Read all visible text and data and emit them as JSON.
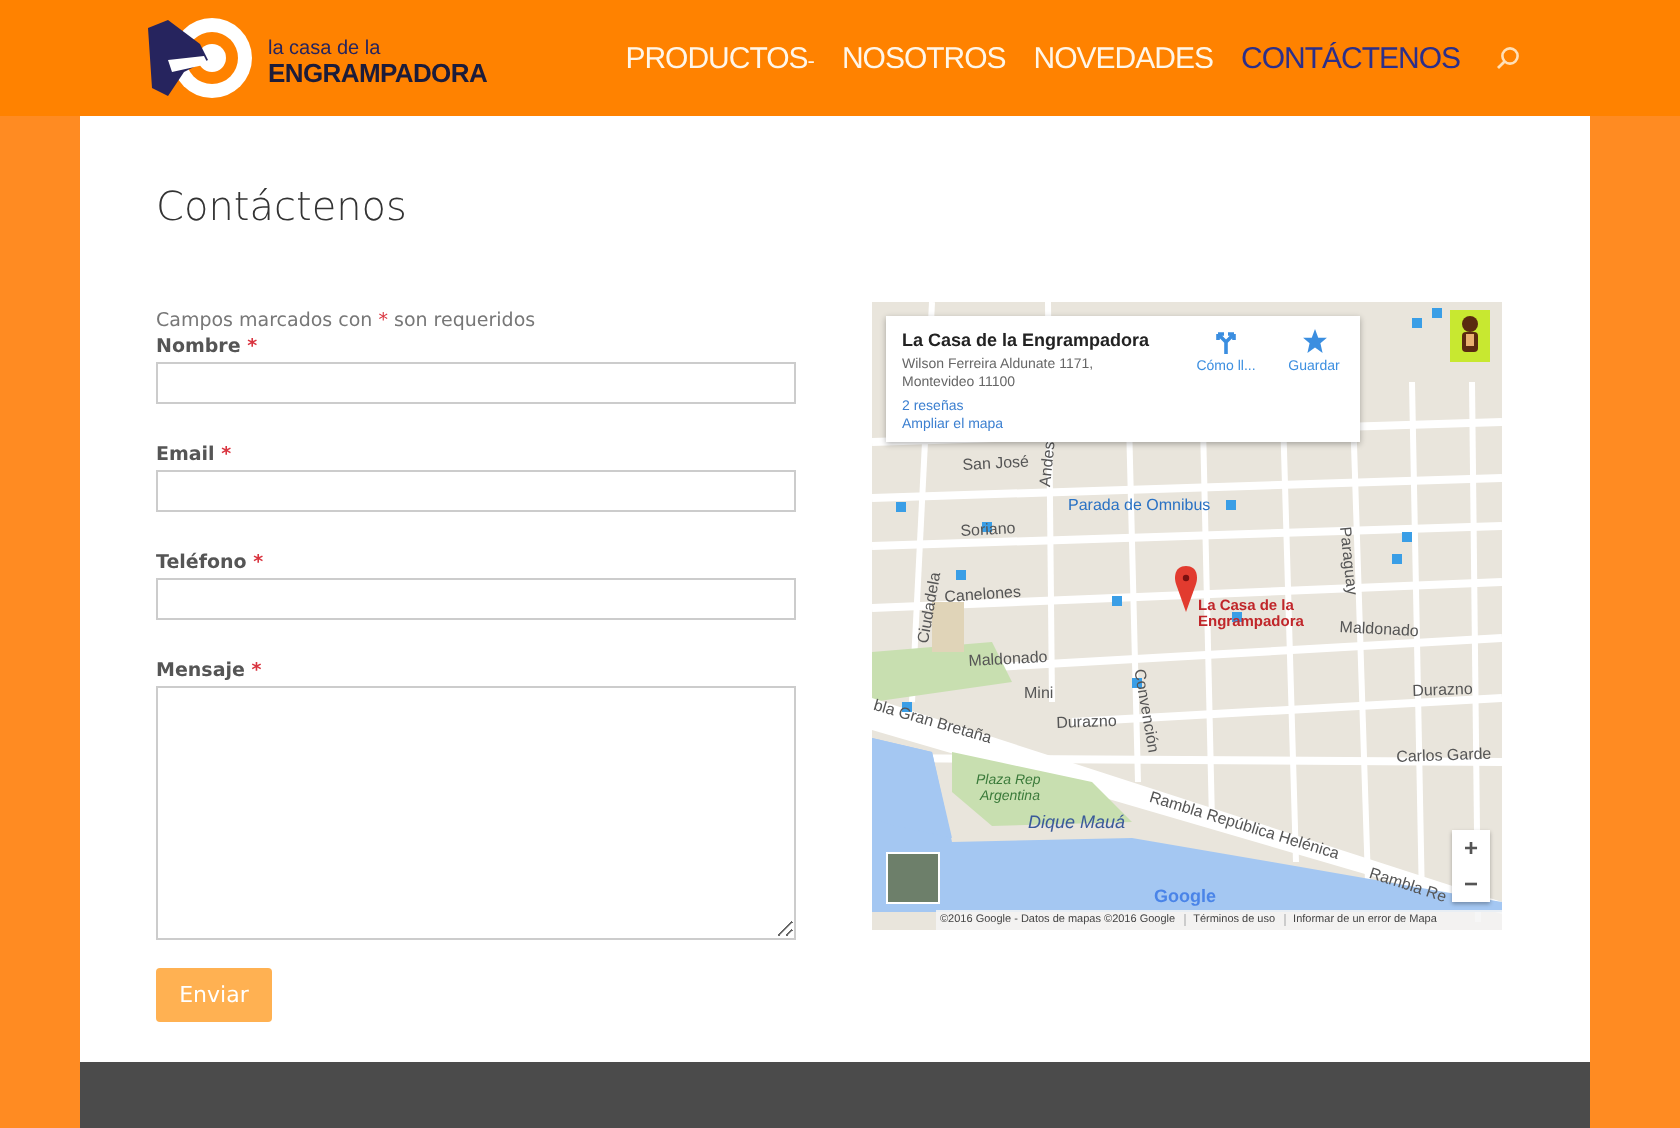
{
  "header": {
    "logo": {
      "line_1": "la casa de la",
      "line_2": "ENGRAMPADORA"
    },
    "nav": [
      {
        "label": "PRODUCTOS",
        "submenu_mark": "-",
        "selected": false
      },
      {
        "label": "NOSOTROS",
        "selected": false
      },
      {
        "label": "NOVEDADES",
        "selected": false
      },
      {
        "label": "CONTÁCTENOS",
        "selected": true
      }
    ]
  },
  "page": {
    "title": "Contáctenos"
  },
  "form": {
    "note": {
      "before": "Campos marcados con",
      "mark": "*",
      "after": "son requeridos"
    },
    "fields": [
      {
        "kind": "input",
        "label": "Nombre",
        "mark": "*"
      },
      {
        "kind": "input",
        "label": "Email",
        "mark": "*"
      },
      {
        "kind": "input",
        "label": "Teléfono",
        "mark": "*"
      },
      {
        "kind": "textarea",
        "label": "Mensaje",
        "mark": "*"
      }
    ],
    "submit": "Enviar"
  },
  "map": {
    "info_card": {
      "title": "La Casa de la Engrampadora",
      "address": [
        "Wilson Ferreira Aldunate 1171,",
        "Montevideo 11100"
      ],
      "links": [
        "2 reseñas",
        "Ampliar el mapa"
      ],
      "actions": [
        {
          "kind": "directions",
          "label": "Cómo ll..."
        },
        {
          "kind": "save",
          "label": "Guardar"
        }
      ]
    },
    "marker_label": [
      "La Casa de la",
      "Engrampadora"
    ],
    "labels": [
      {
        "text": "San José"
      },
      {
        "text": "Andes"
      },
      {
        "text": "Parada de Omnibus"
      },
      {
        "text": "Soriano"
      },
      {
        "text": "Ciudadela"
      },
      {
        "text": "Canelones"
      },
      {
        "text": "Maldonado"
      },
      {
        "text": "Maldonado"
      },
      {
        "text": "Mini"
      },
      {
        "text": "Durazno"
      },
      {
        "text": "Durazno"
      },
      {
        "text": "Convención"
      },
      {
        "text": "Paraguay"
      },
      {
        "text": "Carlos Garde"
      },
      {
        "text": "bla Gran Bretaña"
      },
      {
        "text": "Plaza Rep"
      },
      {
        "text": "Argentina"
      },
      {
        "text": "Dique Mauá"
      },
      {
        "text": "Rambla República Helénica"
      },
      {
        "text": "Rambla Re"
      }
    ],
    "zoom": [
      "+",
      "−"
    ],
    "logo": "Google",
    "attribution": [
      "©2016 Google - Datos de mapas ©2016 Google",
      "Términos de uso",
      "Informar de un error de Mapa"
    ]
  }
}
